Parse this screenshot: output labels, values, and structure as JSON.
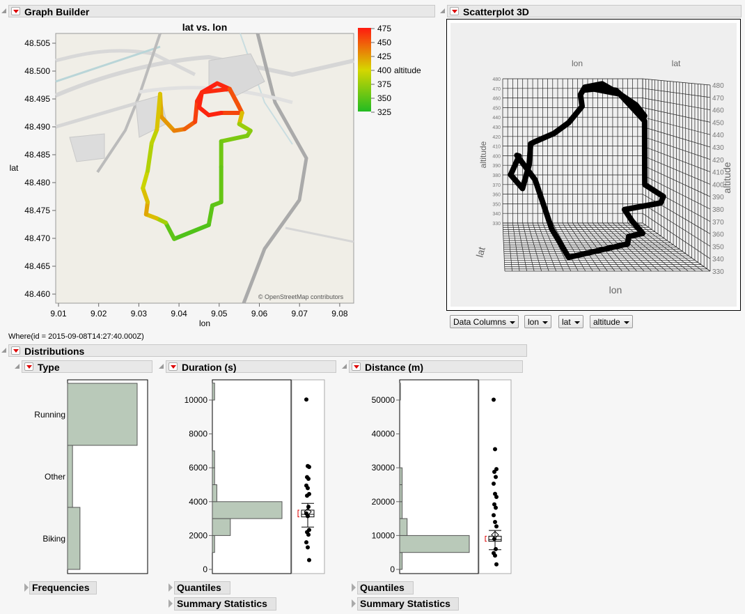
{
  "graph_builder": {
    "header": "Graph Builder",
    "title": "lat vs. lon",
    "xlabel": "lon",
    "ylabel": "lat",
    "legend_title": "altitude",
    "attribution": "© OpenStreetMap contributors",
    "xticks": [
      "9.01",
      "9.02",
      "9.03",
      "9.04",
      "9.05",
      "9.06",
      "9.07",
      "9.08"
    ],
    "yticks": [
      "48.505",
      "48.500",
      "48.495",
      "48.490",
      "48.485",
      "48.480",
      "48.475",
      "48.470",
      "48.465",
      "48.460"
    ],
    "legend_ticks": [
      "475",
      "450",
      "425",
      "400",
      "375",
      "350",
      "325"
    ],
    "colors": {
      "low": "#22bb22",
      "mid": "#d6d600",
      "high": "#ff1a10"
    }
  },
  "chart_data": [
    {
      "type": "line",
      "title": "lat vs. lon",
      "xlabel": "lon",
      "ylabel": "lat",
      "xlim": [
        9.01,
        9.08
      ],
      "ylim": [
        48.46,
        48.505
      ],
      "color_by": "altitude",
      "color_range": [
        325,
        475
      ],
      "route": [
        [
          9.0353,
          48.4959,
          415
        ],
        [
          9.0356,
          48.4918,
          420
        ],
        [
          9.0388,
          48.4893,
          430
        ],
        [
          9.0414,
          48.4896,
          440
        ],
        [
          9.044,
          48.4909,
          455
        ],
        [
          9.0445,
          48.4946,
          465
        ],
        [
          9.0457,
          48.4962,
          472
        ],
        [
          9.0495,
          48.4978,
          475
        ],
        [
          9.0526,
          48.4968,
          465
        ],
        [
          9.0547,
          48.494,
          455
        ],
        [
          9.0557,
          48.4925,
          445
        ],
        [
          9.0505,
          48.4925,
          470
        ],
        [
          9.0474,
          48.4921,
          472
        ],
        [
          9.045,
          48.4935,
          470
        ],
        [
          9.0457,
          48.4962,
          472
        ],
        [
          9.0526,
          48.4968,
          465
        ],
        [
          9.0557,
          48.4925,
          440
        ],
        [
          9.055,
          48.4905,
          380
        ],
        [
          9.0578,
          48.4893,
          370
        ],
        [
          9.057,
          48.4884,
          365
        ],
        [
          9.0505,
          48.4874,
          360
        ],
        [
          9.0505,
          48.4828,
          355
        ],
        [
          9.0505,
          48.4765,
          352
        ],
        [
          9.0483,
          48.4759,
          350
        ],
        [
          9.0474,
          48.4724,
          348
        ],
        [
          9.0388,
          48.4699,
          340
        ],
        [
          9.0367,
          48.4728,
          360
        ],
        [
          9.0344,
          48.4736,
          400
        ],
        [
          9.0318,
          48.4743,
          420
        ],
        [
          9.0322,
          48.4765,
          418
        ],
        [
          9.031,
          48.479,
          400
        ],
        [
          9.0322,
          48.4821,
          390
        ],
        [
          9.0332,
          48.4871,
          380
        ],
        [
          9.0345,
          48.4895,
          400
        ],
        [
          9.0353,
          48.4959,
          415
        ]
      ]
    },
    {
      "type": "scatter3d",
      "title": "Scatterplot 3D",
      "axes": [
        "lon",
        "lat",
        "altitude"
      ],
      "zlim": [
        330,
        480
      ],
      "z_ticks": [
        "480",
        "470",
        "460",
        "450",
        "440",
        "430",
        "420",
        "410",
        "400",
        "390",
        "380",
        "370",
        "360",
        "350",
        "340",
        "330"
      ]
    },
    {
      "type": "bar",
      "title": "Type",
      "categories": [
        "Running",
        "Other",
        "Biking"
      ],
      "values": [
        28,
        2,
        5
      ]
    },
    {
      "type": "histogram",
      "title": "Duration (s)",
      "ylim": [
        0,
        11000
      ],
      "ticks": [
        "10000",
        "8000",
        "6000",
        "4000",
        "2000",
        "0"
      ],
      "bins": [
        [
          1000,
          2000,
          1
        ],
        [
          2000,
          3000,
          8
        ],
        [
          3000,
          4000,
          31
        ],
        [
          4000,
          5000,
          2
        ],
        [
          5000,
          6000,
          1
        ],
        [
          6000,
          7000,
          1
        ],
        [
          10000,
          11000,
          1
        ]
      ],
      "box": {
        "whisker_low": 2500,
        "q1": 3100,
        "median": 3250,
        "q3": 3500,
        "whisker_high": 3900,
        "mean": 3400
      },
      "points": [
        10030,
        6100,
        6050,
        5450,
        5350,
        4950,
        4800,
        4450,
        4350,
        3700,
        3300,
        3150,
        2330,
        2200,
        2050,
        1600,
        1300,
        550
      ]
    },
    {
      "type": "histogram",
      "title": "Distance (m)",
      "ylim": [
        0,
        55000
      ],
      "ticks": [
        "50000",
        "40000",
        "30000",
        "20000",
        "10000",
        "0"
      ],
      "bins": [
        [
          0,
          5000,
          1
        ],
        [
          5000,
          10000,
          28
        ],
        [
          10000,
          15000,
          3
        ],
        [
          15000,
          20000,
          1
        ],
        [
          20000,
          25000,
          1
        ],
        [
          25000,
          30000,
          1
        ],
        [
          50000,
          55000,
          0.3
        ]
      ],
      "box": {
        "whisker_low": 5800,
        "q1": 8300,
        "median": 8800,
        "q3": 9800,
        "whisker_high": 11500,
        "mean": 10200
      },
      "points": [
        50100,
        35500,
        29600,
        28800,
        27300,
        25300,
        22300,
        21400,
        19200,
        18200,
        16000,
        14000,
        12700,
        9000,
        6000,
        4800,
        4100,
        1500
      ]
    }
  ],
  "scatter3d": {
    "header": "Scatterplot 3D",
    "lon_label": "lon",
    "lat_label": "lat",
    "alt_label": "altitude",
    "lon_label_bottom": "lon",
    "lat_label_side": "lat",
    "alt_label_right": "altitude",
    "dropdowns": [
      "Data Columns",
      "lon",
      "lat",
      "altitude"
    ]
  },
  "where_text": "Where(id = 2015-09-08T14:27:40.000Z)",
  "distributions": {
    "header": "Distributions",
    "panels": [
      "Type",
      "Duration (s)",
      "Distance (m)"
    ],
    "buttons": {
      "frequencies": "Frequencies",
      "quantiles1": "Quantiles",
      "summary1": "Summary Statistics",
      "quantiles2": "Quantiles",
      "summary2": "Summary Statistics"
    }
  }
}
